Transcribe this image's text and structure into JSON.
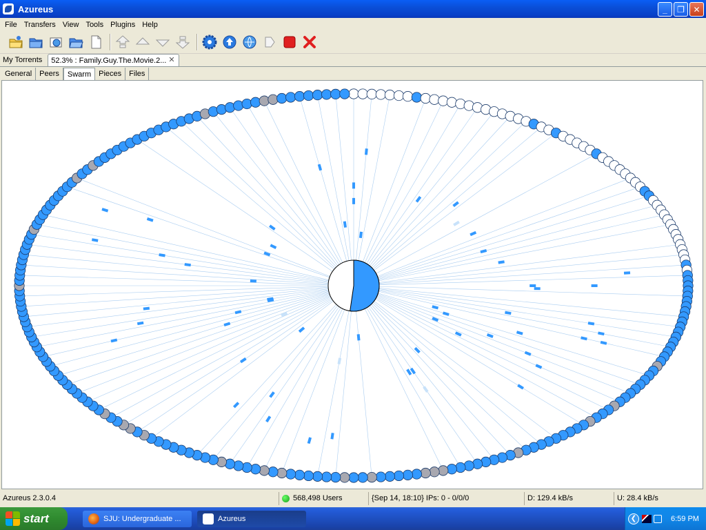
{
  "window": {
    "title": "Azureus",
    "icon": "azureus-frog-icon",
    "controls": {
      "minimize": "_",
      "maximize": "❐",
      "close": "✕"
    }
  },
  "menu": [
    "File",
    "Transfers",
    "View",
    "Tools",
    "Plugins",
    "Help"
  ],
  "toolbar": {
    "buttons": [
      {
        "name": "open-torrent-icon"
      },
      {
        "name": "open-folder-icon"
      },
      {
        "name": "open-url-icon"
      },
      {
        "name": "open-file-icon"
      },
      {
        "name": "new-torrent-icon"
      },
      {
        "name": "move-top-icon"
      },
      {
        "name": "move-up-icon"
      },
      {
        "name": "move-down-icon"
      },
      {
        "name": "move-bottom-icon"
      },
      {
        "name": "settings-icon"
      },
      {
        "name": "start-icon"
      },
      {
        "name": "queue-icon"
      },
      {
        "name": "stop-icon"
      },
      {
        "name": "remove-icon"
      }
    ]
  },
  "torrent_tabs": [
    {
      "label": "My Torrents"
    },
    {
      "label": "52.3% : Family.Guy.The.Movie.2..."
    }
  ],
  "sub_tabs": [
    {
      "label": "General"
    },
    {
      "label": "Peers"
    },
    {
      "label": "Swarm"
    },
    {
      "label": "Pieces"
    },
    {
      "label": "Files"
    }
  ],
  "swarm": {
    "completion_percent": 52.3,
    "colors": {
      "peer": "#3399ff",
      "peer_gray": "#a8a8b0",
      "line": "#a8ccf0",
      "packet": "#3399ff"
    }
  },
  "status": {
    "version": "Azureus 2.3.0.4",
    "users": "568,498 Users",
    "ips": "{Sep 14, 18:10} IPs: 0 - 0/0/0",
    "download": "D: 129.4 kB/s",
    "upload": "U: 28.4 kB/s"
  },
  "taskbar": {
    "start": "start",
    "tasks": [
      {
        "label": "SJU: Undergraduate ...",
        "icon": "firefox-icon"
      },
      {
        "label": "Azureus",
        "icon": "azureus-frog-icon"
      }
    ],
    "clock": "6:59 PM"
  }
}
